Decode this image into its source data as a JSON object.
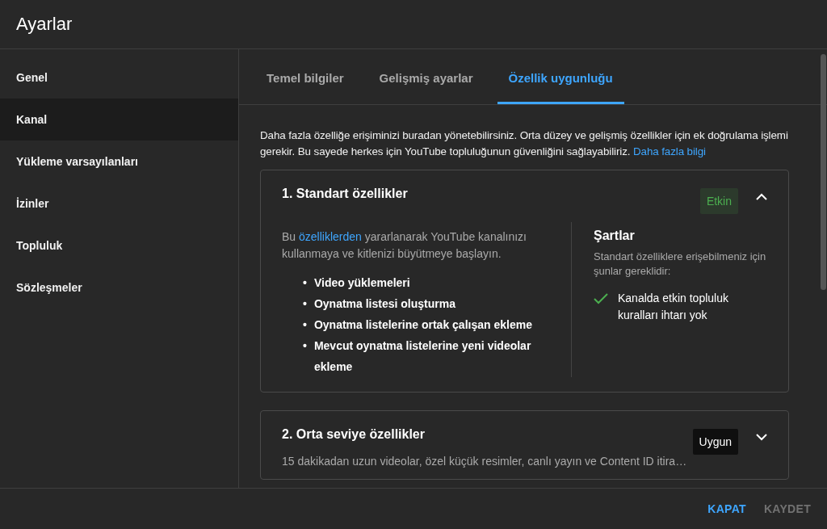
{
  "window": {
    "title": "Ayarlar"
  },
  "sidebar": {
    "items": [
      {
        "label": "Genel",
        "selected": false
      },
      {
        "label": "Kanal",
        "selected": true
      },
      {
        "label": "Yükleme varsayılanları",
        "selected": false
      },
      {
        "label": "İzinler",
        "selected": false
      },
      {
        "label": "Topluluk",
        "selected": false
      },
      {
        "label": "Sözleşmeler",
        "selected": false
      }
    ]
  },
  "tabs": [
    {
      "label": "Temel bilgiler",
      "selected": false
    },
    {
      "label": "Gelişmiş ayarlar",
      "selected": false
    },
    {
      "label": "Özellik uygunluğu",
      "selected": true
    }
  ],
  "intro": {
    "text": "Daha fazla özelliğe erişiminizi buradan yönetebilirsiniz. Orta düzey ve gelişmiş özellikler için ek doğrulama işlemi gerekir. Bu sayede herkes için YouTube topluluğunun güvenliğini sağlayabiliriz.",
    "link": "Daha fazla bilgi"
  },
  "cards": [
    {
      "title": "1. Standart özellikler",
      "status": {
        "label": "Etkin",
        "kind": "active"
      },
      "expanded": true,
      "description": {
        "before": "Bu",
        "link": "özelliklerden",
        "after": "yararlanarak YouTube kanalınızı kullanmaya ve kitlenizi büyütmeye başlayın."
      },
      "features": [
        {
          "marker": "•",
          "label": "Video yüklemeleri"
        },
        {
          "marker": "•",
          "label": "Oynatma listesi oluşturma"
        },
        {
          "marker": "•",
          "label": "Oynatma listelerine ortak çalışan ekleme"
        },
        {
          "marker": "•",
          "label": "Mevcut oynatma listelerine yeni videolar ekleme"
        }
      ],
      "requirements": {
        "title": "Şartlar",
        "text": "Standart özelliklere erişebilmeniz için şunlar gereklidir:",
        "items": [
          {
            "label": "Kanalda etkin topluluk kuralları ihtarı yok",
            "met": true
          }
        ]
      }
    },
    {
      "title": "2. Orta seviye özellikler",
      "status": {
        "label": "Uygun",
        "kind": "eligible"
      },
      "expanded": false,
      "summary": "15 dakikadan uzun videolar, özel küçük resimler, canlı yayın ve Content ID itira…"
    }
  ],
  "footer": {
    "buttons": [
      {
        "label": "KAPAT",
        "disabled": false
      },
      {
        "label": "KAYDET",
        "disabled": true
      }
    ]
  }
}
